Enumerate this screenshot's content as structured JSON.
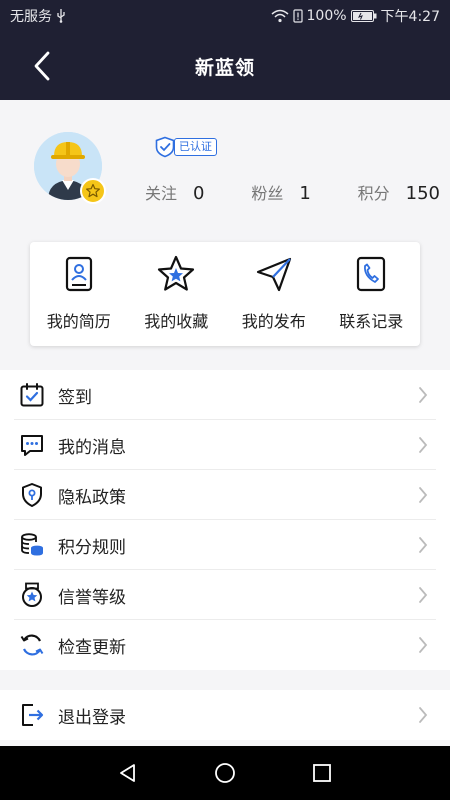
{
  "statusbar": {
    "carrier": "无服务",
    "battery": "100%",
    "time": "下午4:27"
  },
  "nav": {
    "title": "新蓝领"
  },
  "profile": {
    "verified_label": "已认证",
    "stats": [
      {
        "label": "关注",
        "value": "0"
      },
      {
        "label": "粉丝",
        "value": "1"
      },
      {
        "label": "积分",
        "value": "150"
      }
    ]
  },
  "quick": [
    {
      "label": "我的简历",
      "icon": "resume-icon"
    },
    {
      "label": "我的收藏",
      "icon": "star-icon"
    },
    {
      "label": "我的发布",
      "icon": "send-icon"
    },
    {
      "label": "联系记录",
      "icon": "phone-record-icon"
    }
  ],
  "menu": [
    {
      "label": "签到",
      "icon": "calendar-check-icon"
    },
    {
      "label": "我的消息",
      "icon": "message-icon"
    },
    {
      "label": "隐私政策",
      "icon": "shield-icon"
    },
    {
      "label": "积分规则",
      "icon": "coins-icon"
    },
    {
      "label": "信誉等级",
      "icon": "medal-icon"
    },
    {
      "label": "检查更新",
      "icon": "refresh-icon"
    }
  ],
  "menu2": [
    {
      "label": "退出登录",
      "icon": "logout-icon"
    }
  ],
  "colors": {
    "header": "#1f2033",
    "accent": "#2f6fe0",
    "badge": "#f5c518"
  }
}
